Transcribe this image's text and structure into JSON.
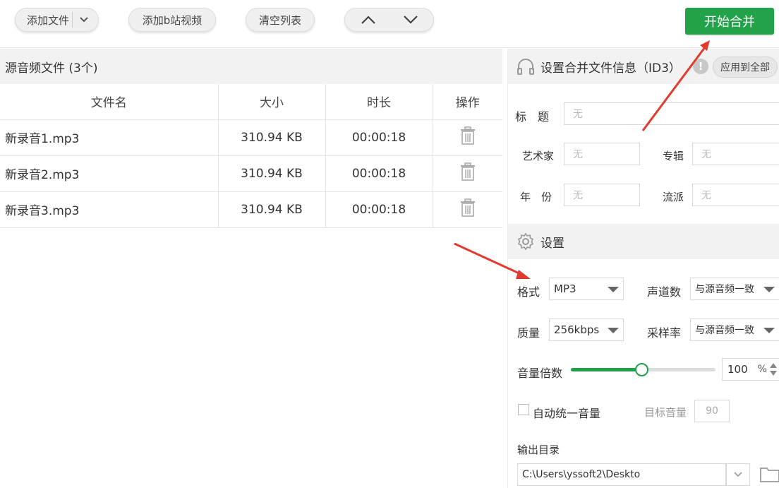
{
  "toolbar": {
    "add_file": "添加文件",
    "add_bilibili": "添加b站视频",
    "clear_list": "清空列表",
    "start_merge": "开始合并"
  },
  "file_list": {
    "title": "源音频文件 (3个)",
    "columns": [
      "文件名",
      "大小",
      "时长",
      "操作"
    ],
    "rows": [
      {
        "name": "新录音1.mp3",
        "size": "310.94 KB",
        "duration": "00:00:18"
      },
      {
        "name": "新录音2.mp3",
        "size": "310.94 KB",
        "duration": "00:00:18"
      },
      {
        "name": "新录音3.mp3",
        "size": "310.94 KB",
        "duration": "00:00:18"
      }
    ]
  },
  "id3": {
    "title": "设置合并文件信息（ID3）",
    "warning_glyph": "!",
    "apply_all": "应用到全部",
    "fields": {
      "title_label": "标　题",
      "artist_label": "艺术家",
      "album_label": "专辑",
      "year_label": "年　份",
      "genre_label": "流派",
      "placeholder": "无"
    }
  },
  "settings": {
    "title": "设置",
    "format_label": "格式",
    "format_value": "MP3",
    "channels_label": "声道数",
    "channels_value": "与源音频一致",
    "quality_label": "质量",
    "quality_value": "256kbps",
    "samplerate_label": "采样率",
    "samplerate_value": "与源音频一致",
    "volume_label": "音量倍数",
    "volume_value": "100",
    "volume_unit": "%",
    "volume_fraction": 0.49,
    "auto_volume_label": "自动统一音量",
    "target_volume_label": "目标音量",
    "target_volume_value": "90",
    "output_dir_label": "输出目录",
    "output_dir_value": "C:\\Users\\yssoft2\\Deskto"
  },
  "colors": {
    "accent_green": "#22a34a",
    "annotation_red": "#e23a2e"
  }
}
